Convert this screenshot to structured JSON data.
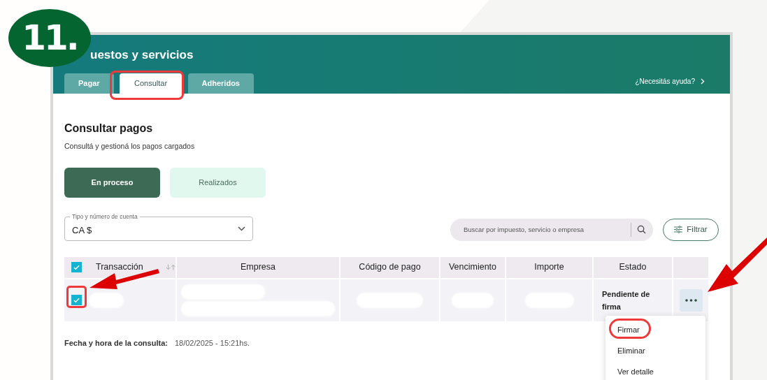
{
  "step_badge": "11.",
  "header": {
    "title": "uestos y servicios",
    "help_link": "¿Necesitás ayuda?"
  },
  "tabs": [
    {
      "label": "Pagar",
      "selected": false
    },
    {
      "label": "Consultar",
      "selected": true
    },
    {
      "label": "Adheridos",
      "selected": false
    }
  ],
  "section": {
    "title": "Consultar pagos",
    "subtitle": "Consultá y gestioná los pagos cargados"
  },
  "segments": [
    {
      "label": "En proceso",
      "selected": true
    },
    {
      "label": "Realizados",
      "selected": false
    }
  ],
  "account_select": {
    "label": "Tipo y número de cuenta",
    "value": "CA $"
  },
  "search": {
    "placeholder": "Buscar por impuesto, servicio o empresa"
  },
  "filter_button": "Filtrar",
  "table": {
    "select_all_checked": true,
    "columns": [
      "Transacción",
      "Empresa",
      "Código de pago",
      "Vencimiento",
      "Importe",
      "Estado"
    ],
    "rows": [
      {
        "checked": true,
        "status": "Pendiente de firma"
      }
    ]
  },
  "query_time": {
    "label": "Fecha y hora de la consulta:",
    "value": "18/02/2025 - 15:21hs."
  },
  "row_menu": [
    "Firmar",
    "Eliminar",
    "Ver detalle"
  ]
}
